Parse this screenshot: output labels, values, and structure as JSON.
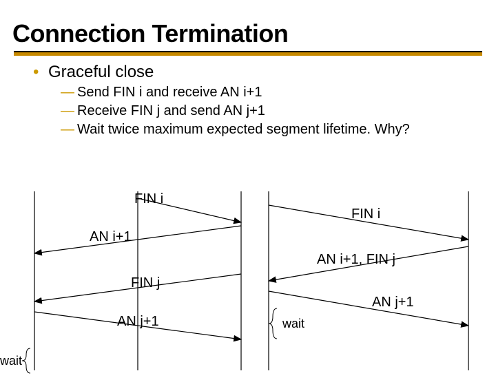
{
  "title": "Connection Termination",
  "main_bullet": "Graceful close",
  "subs": [
    "Send FIN i and receive AN i+1",
    "Receive FIN j and send AN j+1",
    "Wait twice maximum expected segment lifetime. Why?"
  ],
  "left": {
    "fin_i": "FIN i",
    "an_i1": "AN i+1",
    "fin_j": "FIN j",
    "an_j1": "AN j+1",
    "wait": "wait"
  },
  "right": {
    "fin_i": "FIN i",
    "an_i1_fin_j": "AN i+1, FIN j",
    "an_j1": "AN j+1",
    "wait": "wait"
  }
}
